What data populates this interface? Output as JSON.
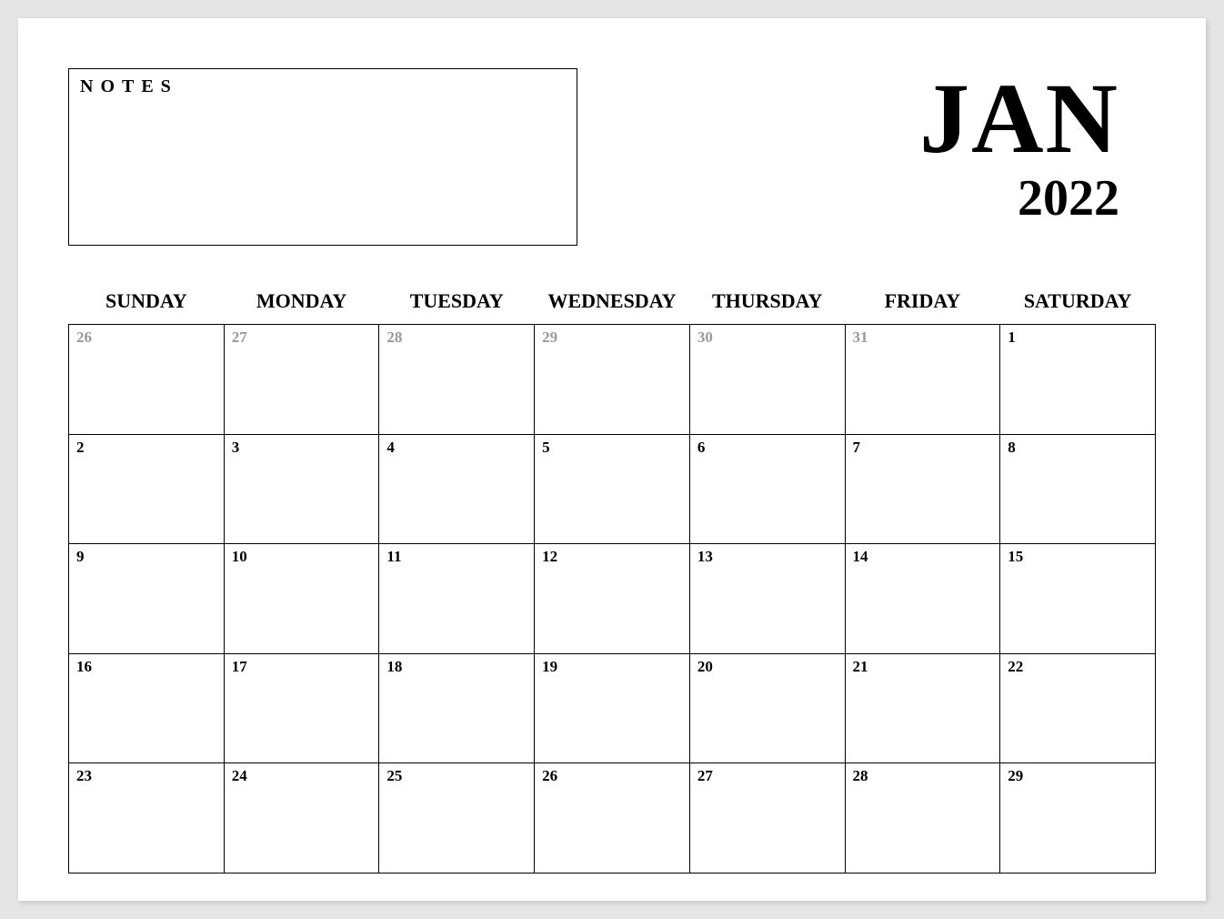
{
  "notes_label": "NOTES",
  "month": "JAN",
  "year": "2022",
  "days_of_week": [
    "SUNDAY",
    "MONDAY",
    "TUESDAY",
    "WEDNESDAY",
    "THURSDAY",
    "FRIDAY",
    "SATURDAY"
  ],
  "weeks": [
    [
      {
        "day": "26",
        "other_month": true
      },
      {
        "day": "27",
        "other_month": true
      },
      {
        "day": "28",
        "other_month": true
      },
      {
        "day": "29",
        "other_month": true
      },
      {
        "day": "30",
        "other_month": true
      },
      {
        "day": "31",
        "other_month": true
      },
      {
        "day": "1",
        "other_month": false
      }
    ],
    [
      {
        "day": "2",
        "other_month": false
      },
      {
        "day": "3",
        "other_month": false
      },
      {
        "day": "4",
        "other_month": false
      },
      {
        "day": "5",
        "other_month": false
      },
      {
        "day": "6",
        "other_month": false
      },
      {
        "day": "7",
        "other_month": false
      },
      {
        "day": "8",
        "other_month": false
      }
    ],
    [
      {
        "day": "9",
        "other_month": false
      },
      {
        "day": "10",
        "other_month": false
      },
      {
        "day": "11",
        "other_month": false
      },
      {
        "day": "12",
        "other_month": false
      },
      {
        "day": "13",
        "other_month": false
      },
      {
        "day": "14",
        "other_month": false
      },
      {
        "day": "15",
        "other_month": false
      }
    ],
    [
      {
        "day": "16",
        "other_month": false
      },
      {
        "day": "17",
        "other_month": false
      },
      {
        "day": "18",
        "other_month": false
      },
      {
        "day": "19",
        "other_month": false
      },
      {
        "day": "20",
        "other_month": false
      },
      {
        "day": "21",
        "other_month": false
      },
      {
        "day": "22",
        "other_month": false
      }
    ],
    [
      {
        "day": "23",
        "other_month": false
      },
      {
        "day": "24",
        "other_month": false
      },
      {
        "day": "25",
        "other_month": false
      },
      {
        "day": "26",
        "other_month": false
      },
      {
        "day": "27",
        "other_month": false
      },
      {
        "day": "28",
        "other_month": false
      },
      {
        "day": "29",
        "other_month": false
      }
    ]
  ]
}
